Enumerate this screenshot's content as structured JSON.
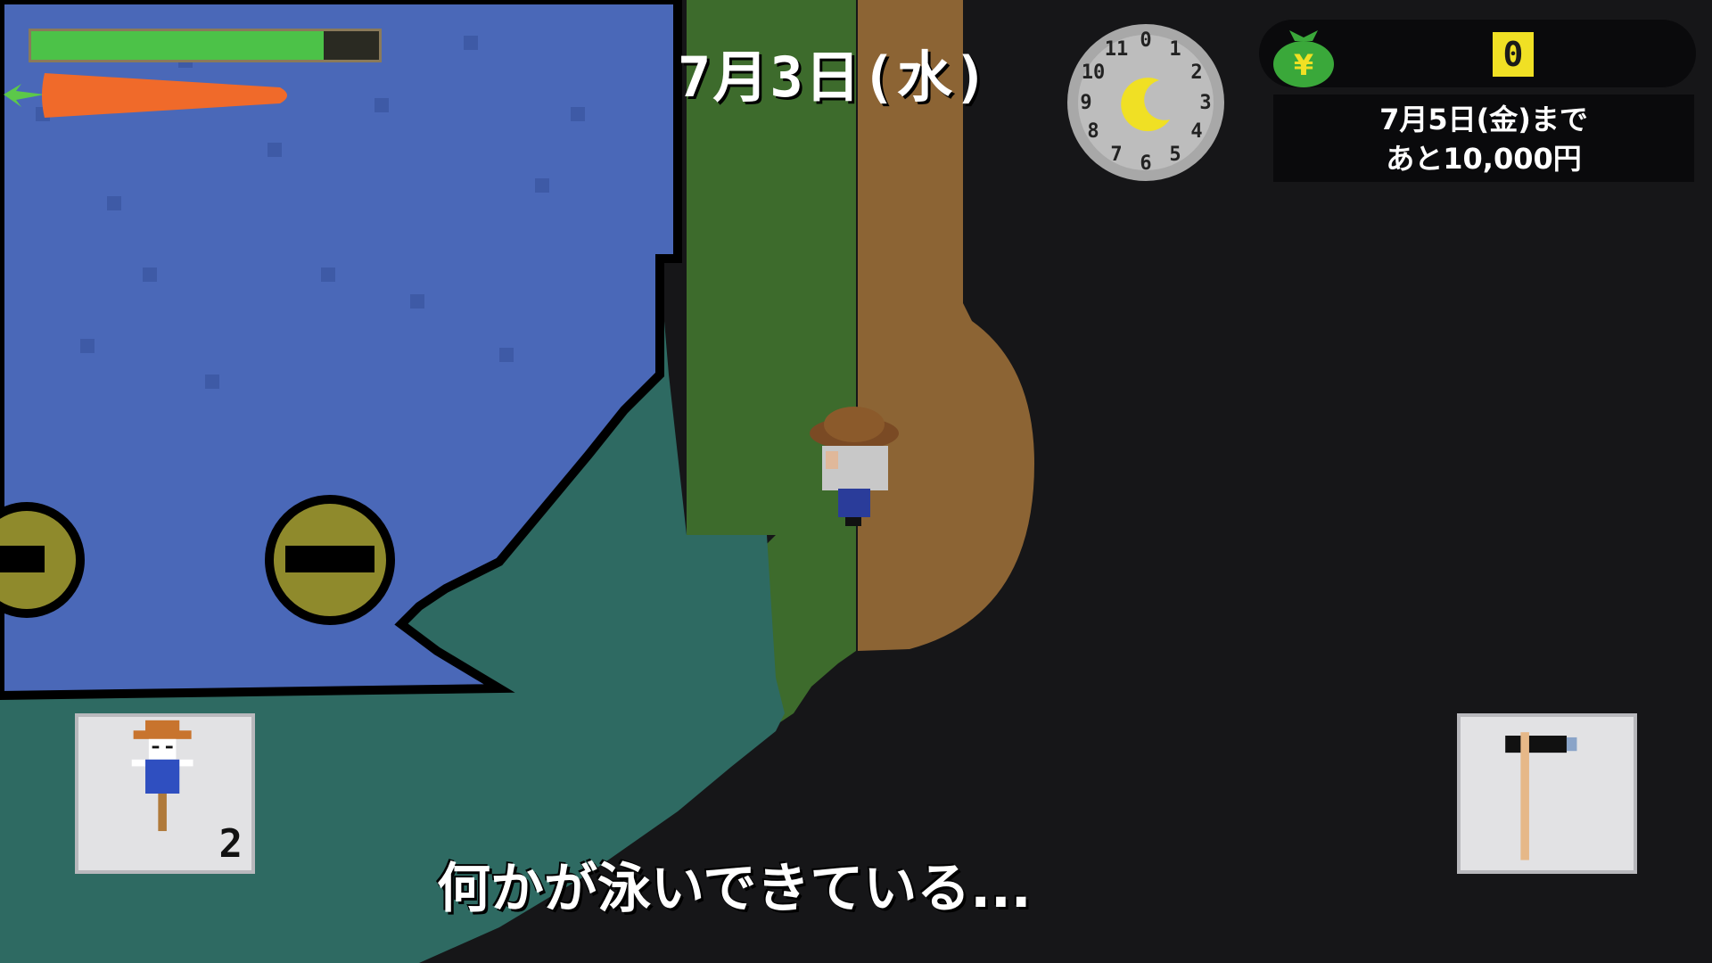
{
  "hud": {
    "health": {
      "level": 0.84,
      "fill_color": "#4cc248"
    },
    "stamina_icon": "carrot-icon",
    "date": "7月3日(水)",
    "clock": {
      "numbers": [
        "0",
        "1",
        "2",
        "3",
        "4",
        "5",
        "6",
        "7",
        "8",
        "9",
        "10",
        "11"
      ],
      "time_icon": "moon-icon"
    },
    "money": {
      "icon": "money-bag-icon",
      "symbol": "¥",
      "amount": "0"
    },
    "deadline": {
      "line1": "7月5日(金)まで",
      "line2": "あと10,000円"
    }
  },
  "inventory": {
    "left_slot": {
      "item": "scarecrow-icon",
      "count": "2"
    },
    "right_slot": {
      "item": "hoe-icon"
    }
  },
  "message": "何かが泳いできている...",
  "colors": {
    "water": "#4a68b8",
    "shallow_water": "#2e6a62",
    "grass": "#3a6a2a",
    "dirt": "#8c6434",
    "night": "#161618"
  }
}
